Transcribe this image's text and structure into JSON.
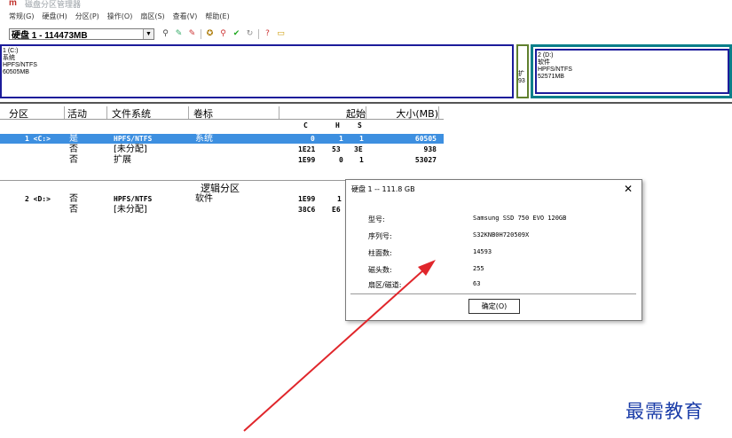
{
  "window": {
    "title": "磁盘分区管理器"
  },
  "menu": [
    "常规(G)",
    "硬盘(H)",
    "分区(P)",
    "操作(O)",
    "扇区(S)",
    "查看(V)",
    "帮助(E)"
  ],
  "toolbar": {
    "disk_select_value": "硬盘 1 - 114473MB"
  },
  "diskmap": {
    "part1": [
      "1 (C:)",
      "系统",
      "HPFS/NTFS",
      "60505MB"
    ],
    "ext": [
      "扩",
      "93"
    ],
    "part2": [
      "2 (D:)",
      "软件",
      "HPFS/NTFS",
      "52571MB"
    ]
  },
  "table": {
    "headers": [
      "分区",
      "活动",
      "文件系统",
      "卷标",
      "起始",
      "大小(MB)"
    ],
    "chs": [
      "C",
      "H",
      "S"
    ],
    "rows": [
      {
        "part": "1 <C:>",
        "active": "是",
        "fs": "HPFS/NTFS",
        "label": "系统",
        "c": "0",
        "h": "1",
        "s": "1",
        "size": "60505"
      },
      {
        "part": "",
        "active": "否",
        "fs": "[未分配]",
        "label": "",
        "c": "1E21",
        "h": "53",
        "s": "3E",
        "size": "938"
      },
      {
        "part": "",
        "active": "否",
        "fs": "扩展",
        "label": "",
        "c": "1E99",
        "h": "0",
        "s": "1",
        "size": "53027"
      }
    ],
    "logical_title": "逻辑分区",
    "logical_rows": [
      {
        "part": "2 <D:>",
        "active": "否",
        "fs": "HPFS/NTFS",
        "label": "软件",
        "c": "1E99",
        "h": "1"
      },
      {
        "part": "",
        "active": "否",
        "fs": "[未分配]",
        "label": "",
        "c": "38C6",
        "h": "E6"
      }
    ]
  },
  "dialog": {
    "title": "硬盘 1 -- 111.8 GB",
    "fields": [
      {
        "label": "型号:",
        "value": "Samsung SSD 750 EVO 120GB"
      },
      {
        "label": "序列号:",
        "value": "S32KNB0H720509X"
      },
      {
        "label": "柱面数:",
        "value": "14593"
      },
      {
        "label": "磁头数:",
        "value": "255"
      },
      {
        "label": "扇区/磁道:",
        "value": "63"
      }
    ],
    "ok_label": "确定(O)"
  },
  "watermark": "最需教育",
  "colors": {
    "selection": "#3d8fe0",
    "arrow": "#e0262b",
    "watermark": "#1a3ca8"
  }
}
